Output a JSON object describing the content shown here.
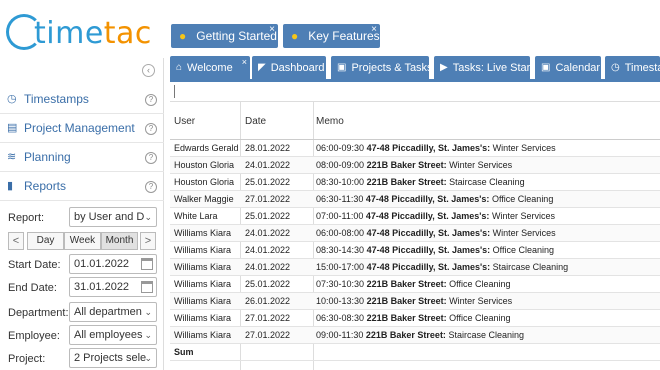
{
  "logo": {
    "part1": "time",
    "part2": "tac"
  },
  "quick_buttons": [
    {
      "label": "Getting Started"
    },
    {
      "label": "Key Features"
    }
  ],
  "sidebar": {
    "collapse_icon": "chevron-left-icon",
    "items": [
      {
        "label": "Timestamps",
        "icon": "clock-icon"
      },
      {
        "label": "Project Management",
        "icon": "clipboard-icon"
      },
      {
        "label": "Planning",
        "icon": "chart-line-icon"
      },
      {
        "label": "Reports",
        "icon": "bar-chart-icon"
      }
    ]
  },
  "report_form": {
    "report_label": "Report:",
    "report_value": "by User and D",
    "period": {
      "day": "Day",
      "week": "Week",
      "month": "Month",
      "active": "Month"
    },
    "start_label": "Start Date:",
    "start_value": "01.01.2022",
    "end_label": "End Date:",
    "end_value": "31.01.2022",
    "department_label": "Department:",
    "department_value": "All departmen",
    "employee_label": "Employee:",
    "employee_value": "All employees",
    "project_label": "Project:",
    "project_value": "2 Projects sele"
  },
  "tabs": [
    {
      "label": "Welcome",
      "icon": "home-icon"
    },
    {
      "label": "Dashboard",
      "icon": "gauge-icon"
    },
    {
      "label": "Projects & Tasks",
      "icon": "calendar-icon"
    },
    {
      "label": "Tasks: Live Start",
      "icon": "play-icon"
    },
    {
      "label": "Calendar",
      "icon": "calendar-icon"
    },
    {
      "label": "Timesta",
      "icon": "clock-icon"
    }
  ],
  "table": {
    "columns": [
      "User",
      "Date",
      "Memo"
    ],
    "rows": [
      {
        "user": "Edwards Gerald",
        "date": "28.01.2022",
        "time": "06:00-09:30",
        "address": "47-48 Piccadilly, St. James's:",
        "service": "Winter Services"
      },
      {
        "user": "Houston Gloria",
        "date": "24.01.2022",
        "time": "08:00-09:00",
        "address": "221B Baker Street:",
        "service": "Winter Services"
      },
      {
        "user": "Houston Gloria",
        "date": "25.01.2022",
        "time": "08:30-10:00",
        "address": "221B Baker Street:",
        "service": "Staircase Cleaning"
      },
      {
        "user": "Walker Maggie",
        "date": "27.01.2022",
        "time": "06:30-11:30",
        "address": "47-48 Piccadilly, St. James's:",
        "service": "Office Cleaning"
      },
      {
        "user": "White Lara",
        "date": "25.01.2022",
        "time": "07:00-11:00",
        "address": "47-48 Piccadilly, St. James's:",
        "service": "Winter Services"
      },
      {
        "user": "Williams Kiara",
        "date": "24.01.2022",
        "time": "06:00-08:00",
        "address": "47-48 Piccadilly, St. James's:",
        "service": "Winter Services"
      },
      {
        "user": "Williams Kiara",
        "date": "24.01.2022",
        "time": "08:30-14:30",
        "address": "47-48 Piccadilly, St. James's:",
        "service": "Office Cleaning"
      },
      {
        "user": "Williams Kiara",
        "date": "24.01.2022",
        "time": "15:00-17:00",
        "address": "47-48 Piccadilly, St. James's:",
        "service": "Staircase Cleaning"
      },
      {
        "user": "Williams Kiara",
        "date": "25.01.2022",
        "time": "07:30-10:30",
        "address": "221B Baker Street:",
        "service": "Office Cleaning"
      },
      {
        "user": "Williams Kiara",
        "date": "26.01.2022",
        "time": "10:00-13:30",
        "address": "221B Baker Street:",
        "service": "Winter Services"
      },
      {
        "user": "Williams Kiara",
        "date": "27.01.2022",
        "time": "06:30-08:30",
        "address": "221B Baker Street:",
        "service": "Office Cleaning"
      },
      {
        "user": "Williams Kiara",
        "date": "27.01.2022",
        "time": "09:00-11:30",
        "address": "221B Baker Street:",
        "service": "Staircase Cleaning"
      }
    ],
    "sum_label": "Sum"
  },
  "colors": {
    "brand_blue": "#2e9ad4",
    "brand_orange": "#f39200",
    "tab_blue": "#4e7fb5",
    "nav_text": "#3a6ea8"
  }
}
